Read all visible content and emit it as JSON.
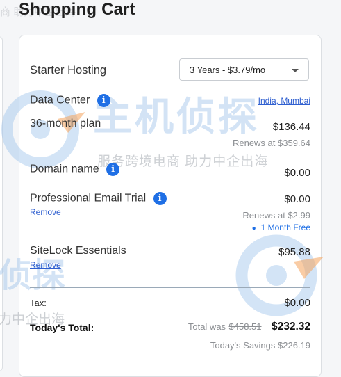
{
  "page": {
    "title": "Shopping Cart"
  },
  "plan": {
    "name": "Starter Hosting",
    "term_select": "3 Years - $3.79/mo"
  },
  "data_center": {
    "label": "Data Center",
    "value": "India, Mumbai"
  },
  "items": {
    "plan_line": {
      "label": "36-month plan",
      "price": "$136.44",
      "renews": "Renews at $359.64"
    },
    "domain": {
      "label": "Domain name",
      "price": "$0.00"
    },
    "email": {
      "label": "Professional Email Trial",
      "price": "$0.00",
      "renews": "Renews at $2.99",
      "remove": "Remove",
      "promo": "1 Month Free"
    },
    "sitelock": {
      "label": "SiteLock Essentials",
      "price": "$95.88",
      "remove": "Remove"
    }
  },
  "summary": {
    "tax_label": "Tax:",
    "tax_value": "$0.00",
    "total_label": "Today's Total:",
    "total_was_prefix": "Total was",
    "total_was_value": "$458.51",
    "total_value": "$232.32",
    "savings": "Today's Savings $226.19"
  },
  "watermark": {
    "brand_cn": "主机侦探",
    "slogan_cn": "服务跨境电商 助力中企出海",
    "partial_top": "商 助力中企出海",
    "partial_bottom": "力中企出海",
    "partial_brand": "侦探"
  },
  "colors": {
    "accent": "#1f6fe5",
    "link": "#2f5fd0",
    "watermark_orange": "#f4a35b",
    "watermark_blue": "#9ec3ea"
  }
}
